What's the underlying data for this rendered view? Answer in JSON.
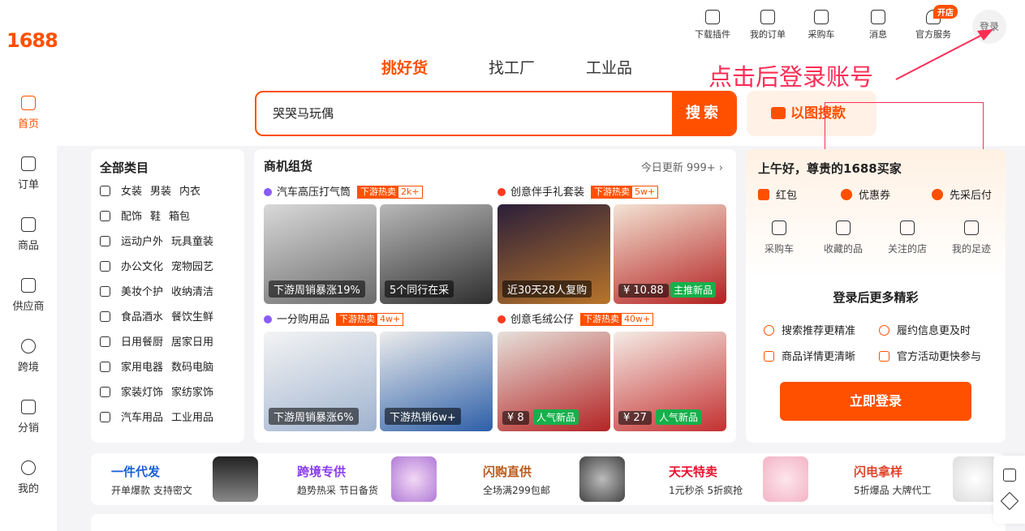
{
  "logo": "1688",
  "rail": [
    {
      "label": "首页",
      "active": true
    },
    {
      "label": "订单"
    },
    {
      "label": "商品"
    },
    {
      "label": "供应商"
    },
    {
      "label": "跨境"
    },
    {
      "label": "分销"
    },
    {
      "label": "我的"
    }
  ],
  "topbar": {
    "items": [
      "下载插件",
      "我的订单",
      "采购车",
      "消息",
      "官方服务"
    ],
    "badge": "开店",
    "login": "登录"
  },
  "search": {
    "tabs": [
      "挑好货",
      "找工厂",
      "工业品"
    ],
    "value": "哭哭马玩偶",
    "button": "搜索",
    "image_search": "以图搜款"
  },
  "annotation": "点击后登录账号",
  "categories": {
    "title": "全部类目",
    "rows": [
      [
        "女装",
        "男装",
        "内衣"
      ],
      [
        "配饰",
        "鞋",
        "箱包"
      ],
      [
        "运动户外",
        "玩具童装"
      ],
      [
        "办公文化",
        "宠物园艺"
      ],
      [
        "美妆个护",
        "收纳清洁"
      ],
      [
        "食品酒水",
        "餐饮生鲜"
      ],
      [
        "日用餐厨",
        "居家日用"
      ],
      [
        "家用电器",
        "数码电脑"
      ],
      [
        "家装灯饰",
        "家纺家饰"
      ],
      [
        "汽车用品",
        "工业用品"
      ]
    ]
  },
  "biz": {
    "title": "商机组货",
    "more": "今日更新 999+ ›",
    "hot_label": "下游热卖",
    "groups": [
      {
        "title": "汽车高压打气筒",
        "count": "2k+",
        "cards": [
          {
            "cap": "下游周销暴涨19%"
          },
          {
            "cap": "5个同行在采"
          }
        ]
      },
      {
        "title": "创意伴手礼套装",
        "count": "5w+",
        "cards": [
          {
            "cap": "近30天28人复购"
          },
          {
            "cap": "¥ 10.88",
            "tag": "主推新品"
          }
        ]
      },
      {
        "title": "一分购用品",
        "count": "4w+",
        "cards": [
          {
            "cap": "下游周销暴涨6%"
          },
          {
            "cap": "下游热销6w+"
          }
        ]
      },
      {
        "title": "创意毛绒公仔",
        "count": "40w+",
        "cards": [
          {
            "cap": "¥ 8",
            "tag": "人气新品"
          },
          {
            "cap": "¥ 27",
            "tag": "人气新品"
          }
        ]
      }
    ]
  },
  "user": {
    "greeting": "上午好，尊贵的1688买家",
    "perks": [
      "红包",
      "优惠券",
      "先采后付"
    ],
    "links": [
      "采购车",
      "收藏的品",
      "关注的店",
      "我的足迹"
    ],
    "more_title": "登录后更多精彩",
    "features": [
      "搜索推荐更精准",
      "履约信息更及时",
      "商品详情更清晰",
      "官方活动更快参与"
    ],
    "login_button": "立即登录"
  },
  "promo": [
    {
      "title": "一件代发",
      "sub": "开单爆款 支持密文",
      "color": "#1a5fd9"
    },
    {
      "title": "跨境专供",
      "sub": "趋势热采 节日备货",
      "color": "#8a3cf0"
    },
    {
      "title": "闪购直供",
      "sub": "全场满299包邮",
      "color": "#b85a1a"
    },
    {
      "title": "天天特卖",
      "sub": "1元秒杀 5折疯抢",
      "color": "#e8102b"
    },
    {
      "title": "闪电拿样",
      "sub": "5折爆品 大牌代工",
      "color": "#e0452c"
    }
  ],
  "colors": {
    "brand": "#ff5000",
    "annotation": "#ff2d55"
  }
}
